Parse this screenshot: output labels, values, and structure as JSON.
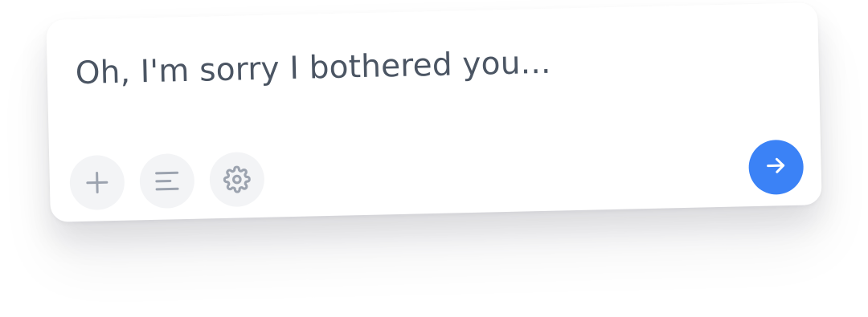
{
  "composer": {
    "message_text": "Oh, I'm sorry I bothered you...",
    "toolbar": {
      "buttons": [
        {
          "icon": "plus-icon",
          "color": "#9ca3af"
        },
        {
          "icon": "align-left-icon",
          "color": "#9ca3af"
        },
        {
          "icon": "gear-icon",
          "color": "#9ca3af"
        }
      ]
    },
    "send_button": {
      "icon": "arrow-right-icon",
      "color": "#3b82f6"
    }
  }
}
